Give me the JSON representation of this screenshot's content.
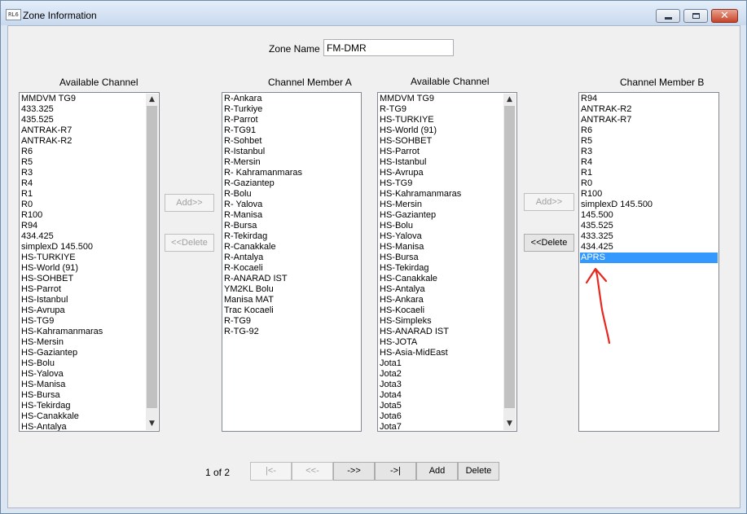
{
  "window": {
    "title": "Zone Information",
    "app_icon_text": "RL6",
    "close_glyph": "✕"
  },
  "zone_name": {
    "label": "Zone Name",
    "value": "FM-DMR"
  },
  "lists": {
    "available_a": {
      "header": "Available Channel",
      "items": [
        "MMDVM TG9",
        "433.325",
        "435.525",
        "ANTRAK-R7",
        "ANTRAK-R2",
        "R6",
        "R5",
        "R3",
        "R4",
        "R1",
        "R0",
        "R100",
        "R94",
        "434.425",
        "simplexD 145.500",
        "HS-TURKIYE",
        "HS-World (91)",
        "HS-SOHBET",
        "HS-Parrot",
        "HS-Istanbul",
        "HS-Avrupa",
        "HS-TG9",
        "HS-Kahramanmaras",
        "HS-Mersin",
        "HS-Gaziantep",
        "HS-Bolu",
        "HS-Yalova",
        "HS-Manisa",
        "HS-Bursa",
        "HS-Tekirdag",
        "HS-Canakkale",
        "HS-Antalya"
      ]
    },
    "member_a": {
      "header": "Channel Member A",
      "items": [
        "R-Ankara",
        "R-Turkiye",
        "R-Parrot",
        "R-TG91",
        "R-Sohbet",
        "R-Istanbul",
        "R-Mersin",
        "R- Kahramanmaras",
        "R-Gaziantep",
        "R-Bolu",
        "R- Yalova",
        "R-Manisa",
        "R-Bursa",
        "R-Tekirdag",
        "R-Canakkale",
        "R-Antalya",
        "R-Kocaeli",
        "R-ANARAD IST",
        "YM2KL Bolu",
        "Manisa MAT",
        "Trac Kocaeli",
        "R-TG9",
        "R-TG-92"
      ]
    },
    "available_b": {
      "header": "Available Channel",
      "items": [
        "MMDVM TG9",
        "R-TG9",
        "HS-TURKIYE",
        "HS-World (91)",
        "HS-SOHBET",
        "HS-Parrot",
        "HS-Istanbul",
        "HS-Avrupa",
        "HS-TG9",
        "HS-Kahramanmaras",
        "HS-Mersin",
        "HS-Gaziantep",
        "HS-Bolu",
        "HS-Yalova",
        "HS-Manisa",
        "HS-Bursa",
        "HS-Tekirdag",
        "HS-Canakkale",
        "HS-Antalya",
        "HS-Ankara",
        "HS-Kocaeli",
        "HS-Simpleks",
        "HS-ANARAD IST",
        "HS-JOTA",
        "HS-Asia-MidEast",
        "Jota1",
        "Jota2",
        "Jota3",
        "Jota4",
        "Jota5",
        "Jota6",
        "Jota7"
      ]
    },
    "member_b": {
      "header": "Channel Member B",
      "items": [
        "R94",
        "ANTRAK-R2",
        "ANTRAK-R7",
        "R6",
        "R5",
        "R3",
        "R4",
        "R1",
        "R0",
        "R100",
        "simplexD 145.500",
        "145.500",
        "435.525",
        "433.325",
        "434.425",
        "APRS"
      ],
      "selected": "APRS"
    }
  },
  "buttons": {
    "add_a": "Add>>",
    "delete_a": "<<Delete",
    "add_b": "Add>>",
    "delete_b": "<<Delete"
  },
  "scroll_arrows": {
    "up": "▲",
    "down": "▼"
  },
  "scroll_level": {
    "available_a": 0.0,
    "available_b": 0.0
  },
  "pager": {
    "page_text": "1 of 2",
    "first": "|<-",
    "prev": "<<-",
    "next": "->>",
    "last": "->|",
    "add": "Add",
    "delete": "Delete"
  },
  "annotation_color": "#e8281e"
}
